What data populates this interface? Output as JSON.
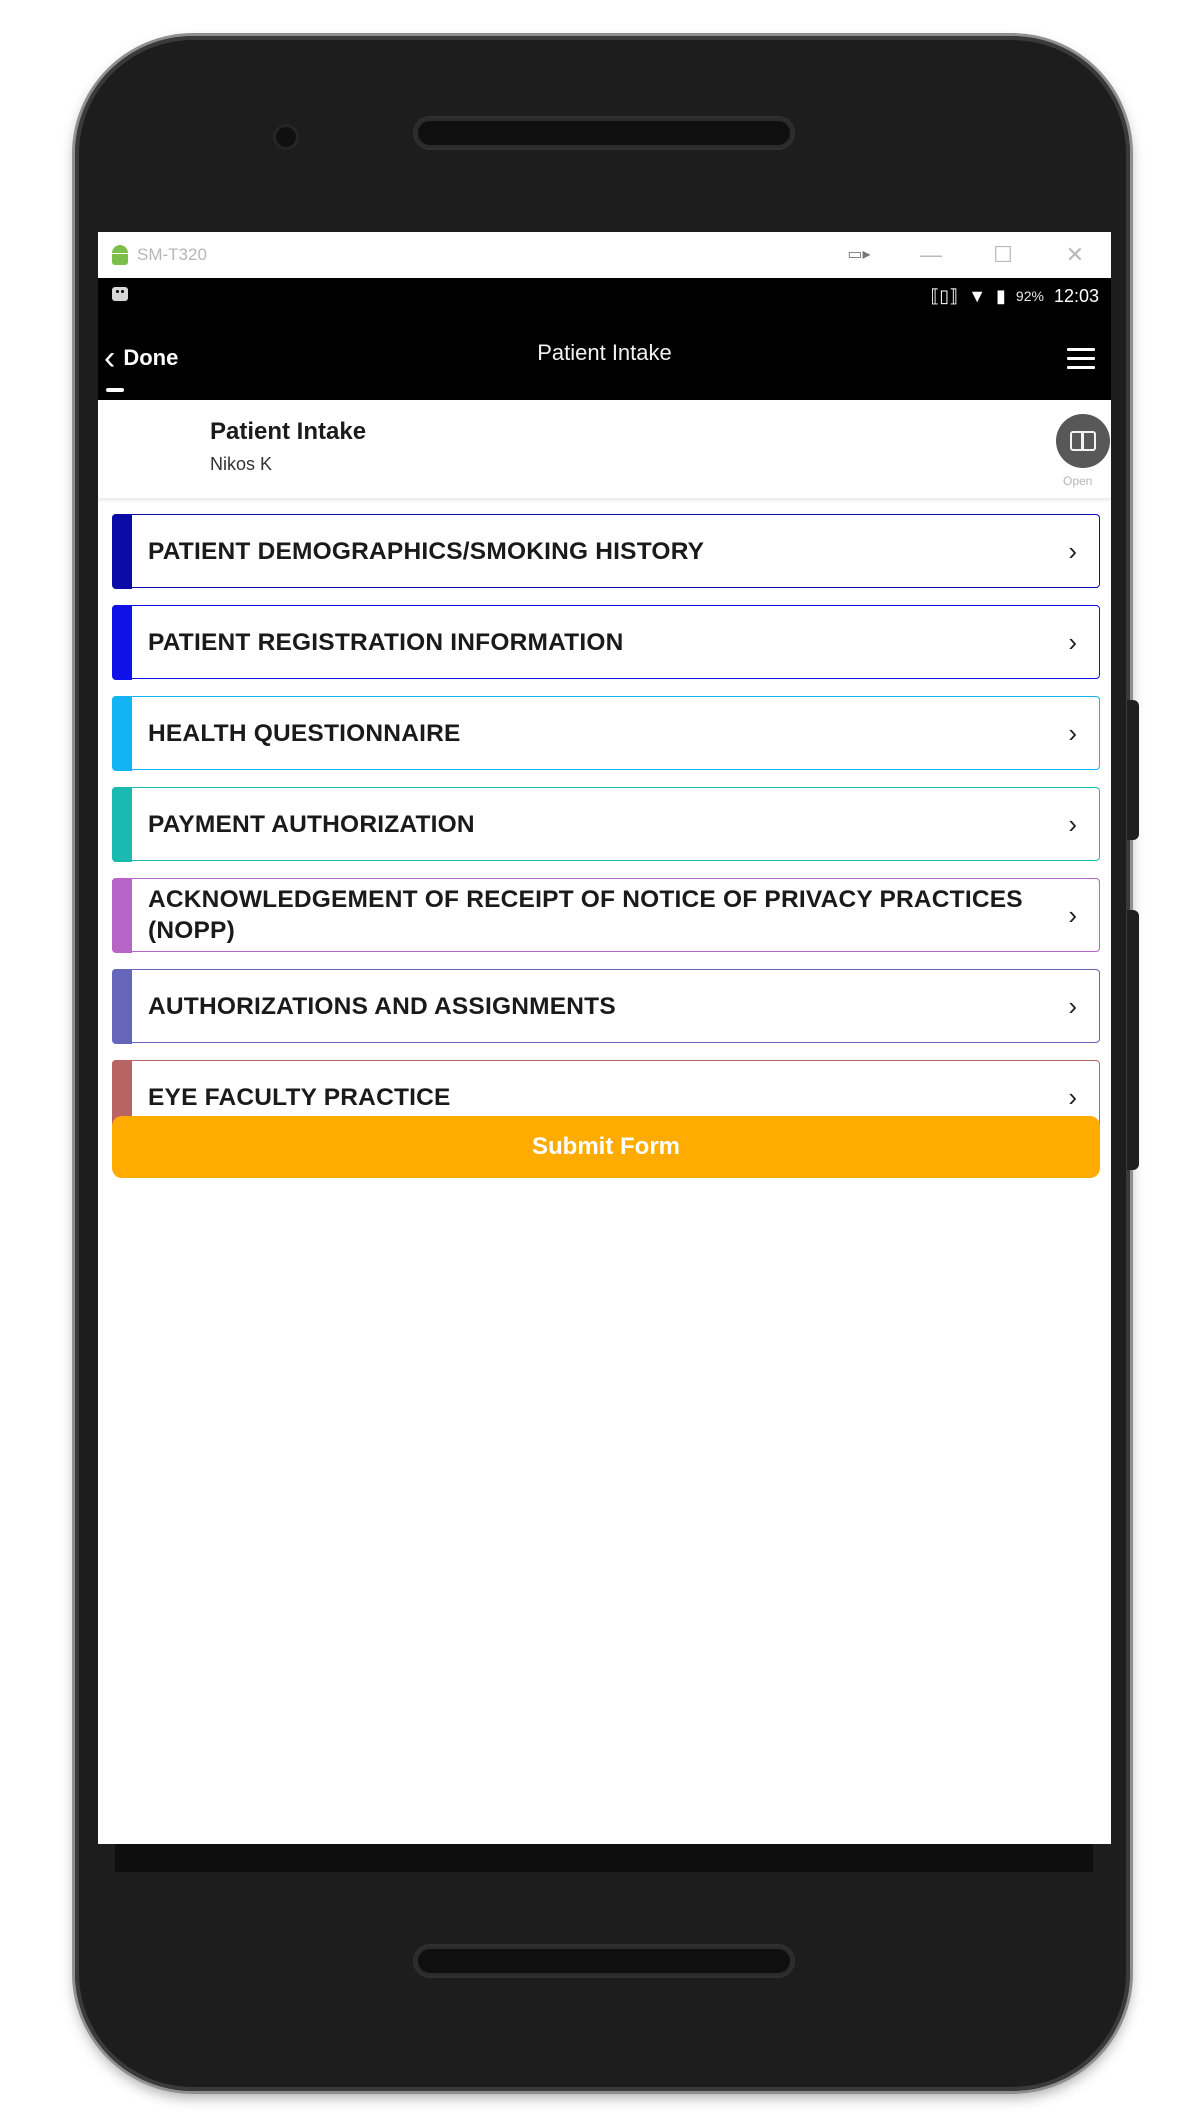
{
  "emulator": {
    "title": "SM-T320",
    "cast_icon": "cast-icon",
    "minimize": "—",
    "maximize": "☐",
    "close": "✕"
  },
  "status_bar": {
    "battery_percent": "92%",
    "time": "12:03",
    "icons": [
      "robot-icon",
      "vibrate-icon",
      "wifi-icon",
      "battery-icon"
    ]
  },
  "header": {
    "back_label": "Done",
    "title": "Patient Intake",
    "menu_icon": "hamburger-menu-icon"
  },
  "form": {
    "title": "Patient Intake",
    "subtitle": "Nikos K",
    "open_label": "Open"
  },
  "sections": [
    {
      "label": "PATIENT DEMOGRAPHICS/SMOKING HISTORY",
      "color": "#0b0ba8"
    },
    {
      "label": "PATIENT REGISTRATION INFORMATION",
      "color": "#1010e8"
    },
    {
      "label": "HEALTH QUESTIONNAIRE",
      "color": "#13b4f2"
    },
    {
      "label": "PAYMENT AUTHORIZATION",
      "color": "#1bbab0"
    },
    {
      "label": "ACKNOWLEDGEMENT OF RECEIPT OF NOTICE OF PRIVACY PRACTICES (NOPP)",
      "color": "#b865c8"
    },
    {
      "label": "AUTHORIZATIONS AND ASSIGNMENTS",
      "color": "#6565bb"
    },
    {
      "label": "EYE FACULTY PRACTICE",
      "color": "#b86464"
    }
  ],
  "submit": {
    "label": "Submit Form",
    "color": "#ffab00"
  }
}
